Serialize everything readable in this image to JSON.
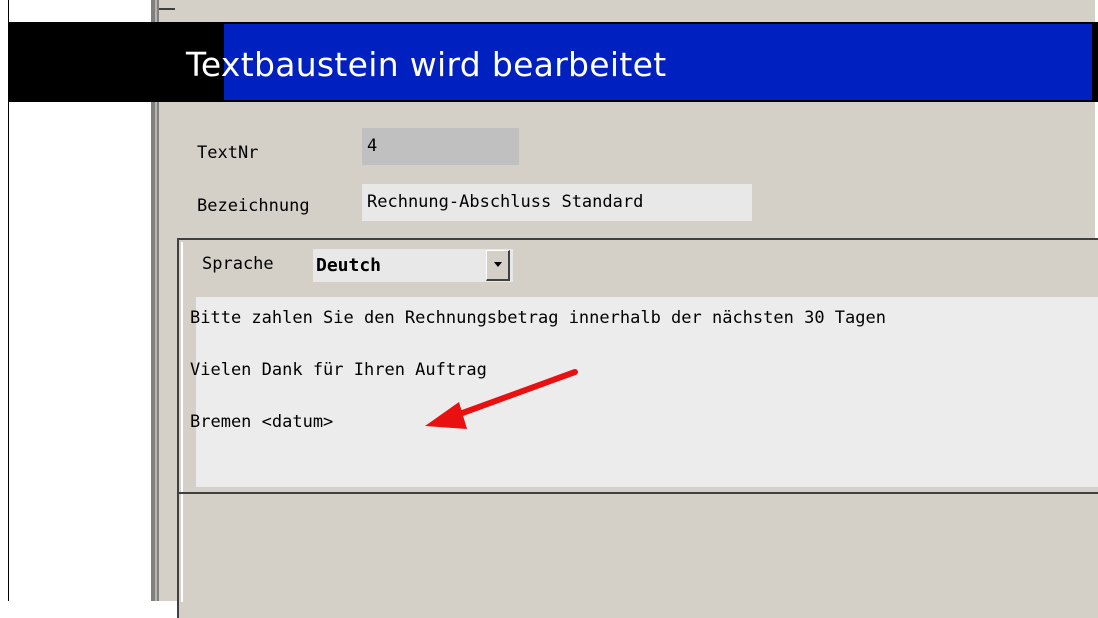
{
  "window": {
    "title": "Textbaustein wird bearbeitet"
  },
  "form": {
    "textnr_label": "TextNr",
    "textnr_value": "4",
    "bezeichnung_label": "Bezeichnung",
    "bezeichnung_value": "Rechnung-Abschluss Standard"
  },
  "language": {
    "label": "Sprache",
    "selected": "Deutch"
  },
  "text_content": {
    "lines": [
      "Bitte zahlen Sie den Rechnungsbetrag innerhalb der nächsten 30 Tagen",
      "Vielen Dank für Ihren Auftrag",
      "Bremen <datum>"
    ]
  },
  "annotation": {
    "arrow_color": "#e81010"
  },
  "colors": {
    "title_bar_blue": "#0020c0",
    "window_bg": "#d4d0c8",
    "field_readonly": "#c0c0c0",
    "field_edit": "#e8e8e8"
  }
}
